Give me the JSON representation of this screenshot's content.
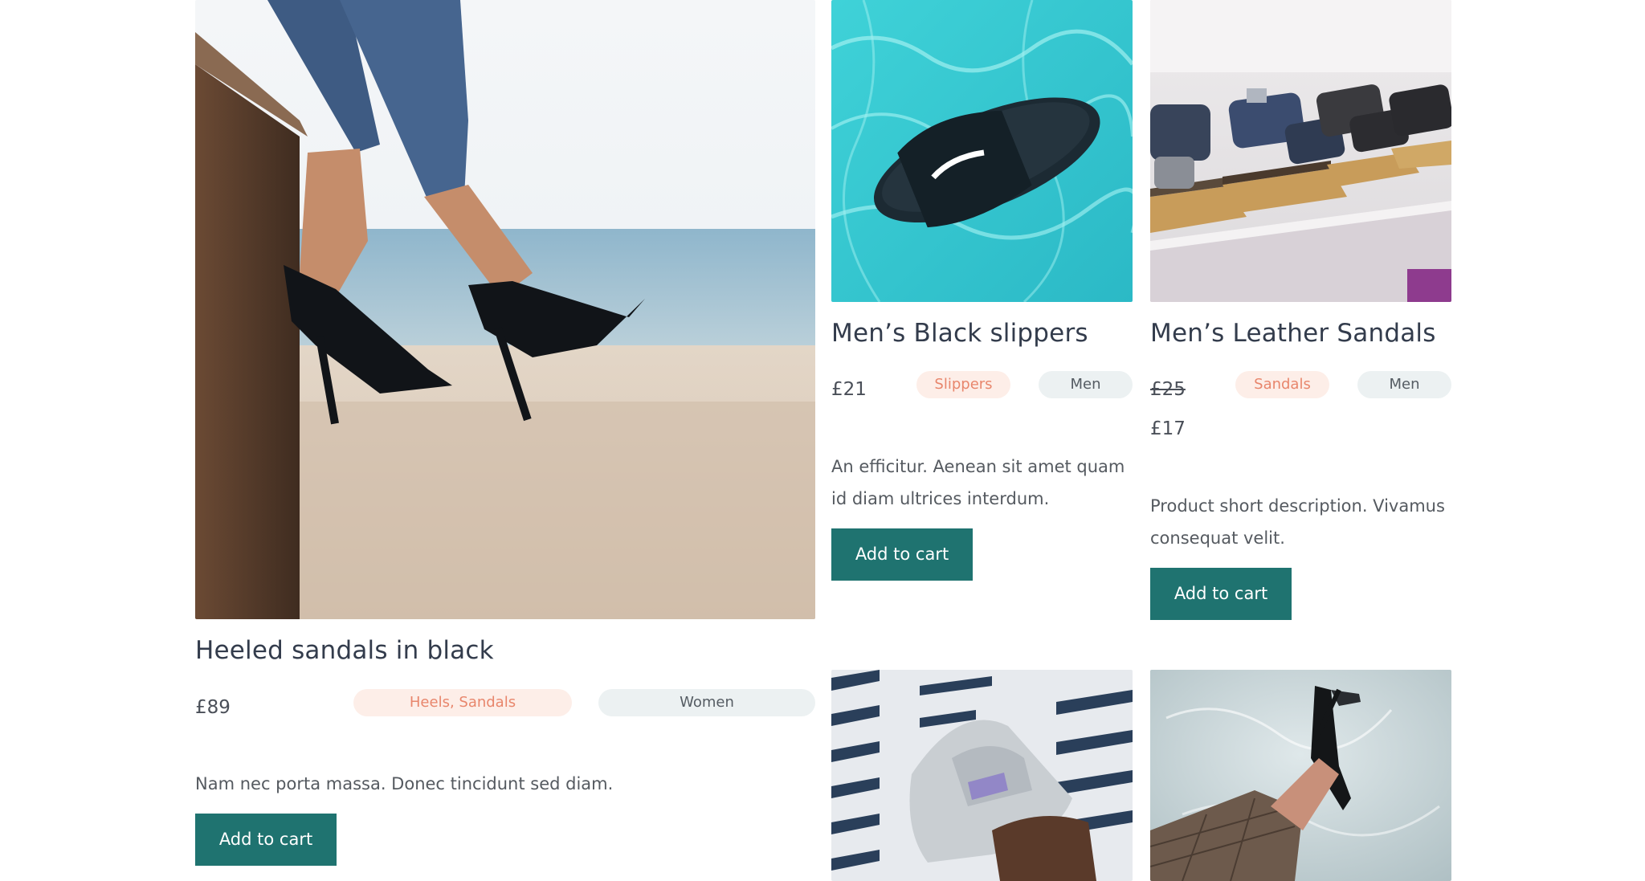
{
  "products": [
    {
      "title": "Heeled sandals in black",
      "price": "£89",
      "category": "Heels, Sandals",
      "gender": "Women",
      "description": "Nam nec porta massa. Donec tincidunt sed diam.",
      "button": "Add to cart",
      "image": "woman-black-heels-photo"
    },
    {
      "title": "Men’s Black slippers",
      "price": "£21",
      "category": "Slippers",
      "gender": "Men",
      "description": "An efficitur. Aenean sit amet quam id diam ultrices interdum.",
      "button": "Add to cart",
      "image": "black-slipper-pool-photo"
    },
    {
      "title": "Men’s Leather Sandals",
      "old_price": "£25",
      "price": "£17",
      "category": "Sandals",
      "gender": "Men",
      "description": "Product short description. Vivamus consequat velit.",
      "button": "Add to cart",
      "image": "leather-sandals-shelf-photo"
    },
    {
      "image": "grey-sneaker-building-photo"
    },
    {
      "image": "black-patent-heel-photo"
    }
  ],
  "colors": {
    "button": "#1f7370",
    "category_tag_bg": "#fdeee8",
    "category_tag_text": "#e8866c",
    "gender_tag_bg": "#ecf1f2"
  }
}
